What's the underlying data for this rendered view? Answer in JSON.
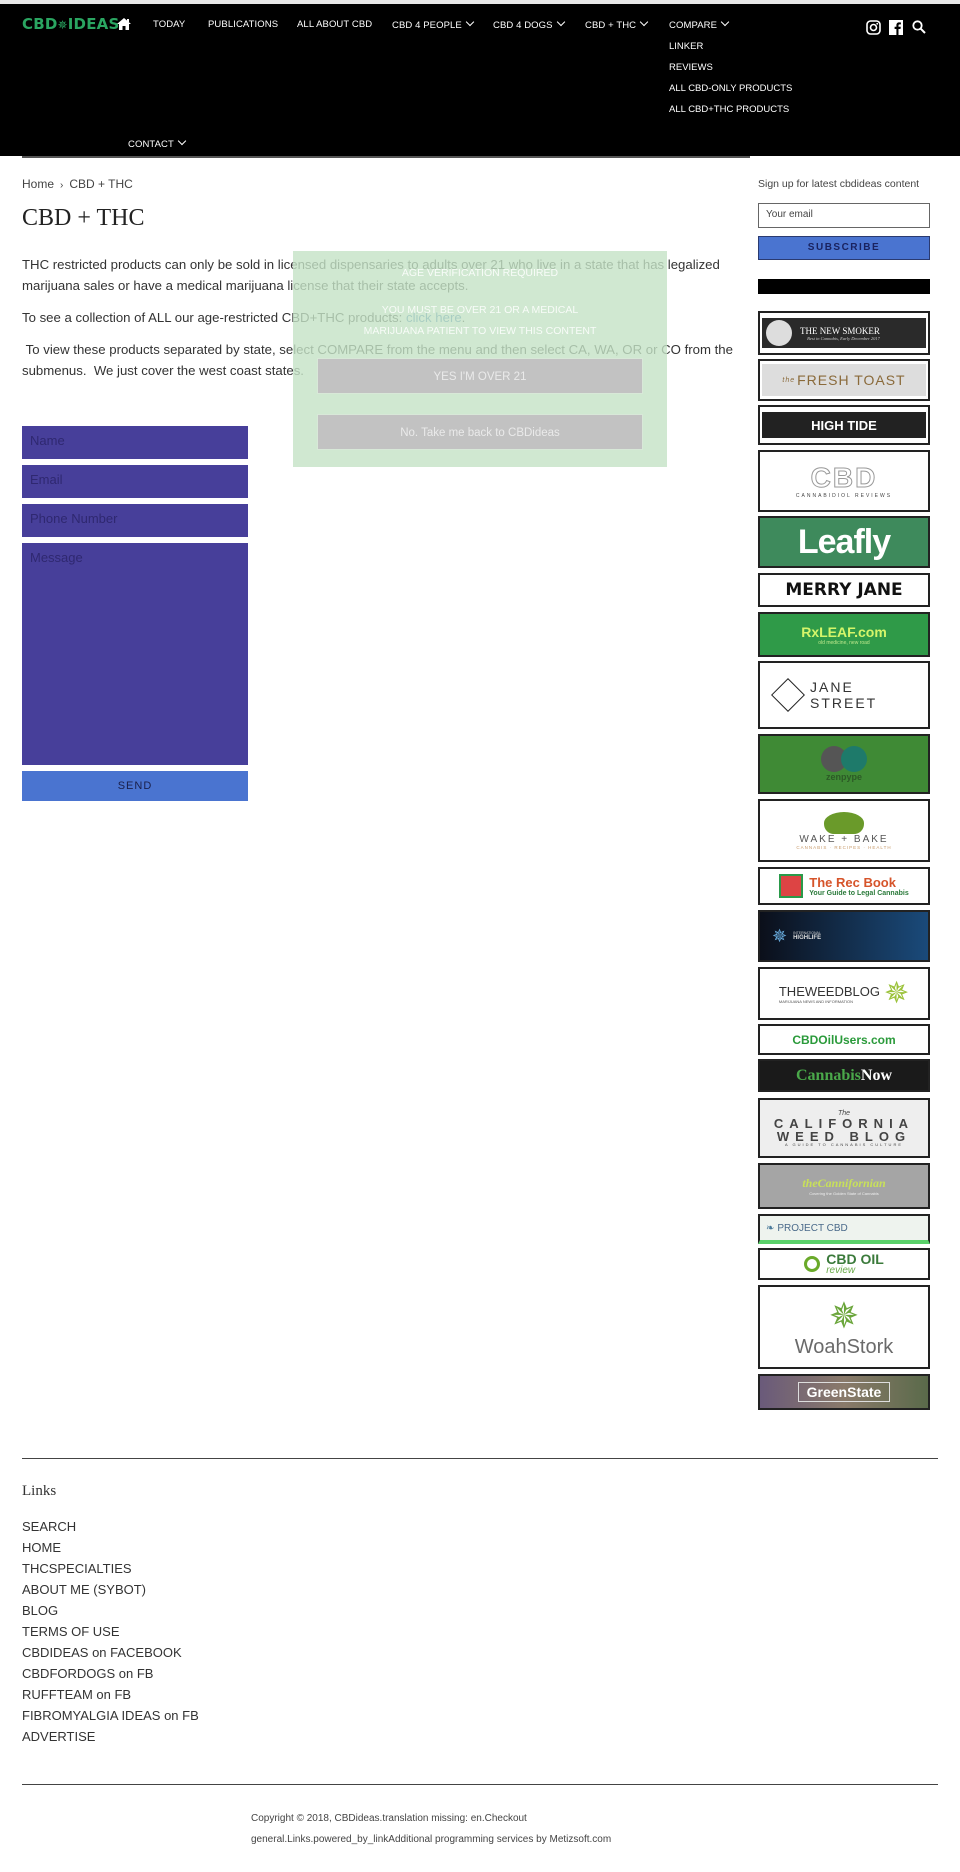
{
  "header": {
    "logo": {
      "left": "CBD",
      "leaf": "✵",
      "right": "IDEAS"
    },
    "nav": [
      {
        "label": "TODAY",
        "dropdown": false
      },
      {
        "label": "PUBLICATIONS",
        "dropdown": false
      },
      {
        "label": "ALL ABOUT CBD",
        "dropdown": false
      },
      {
        "label": "CBD 4 PEOPLE",
        "dropdown": true
      },
      {
        "label": "CBD 4 DOGS",
        "dropdown": true
      },
      {
        "label": "CBD + THC",
        "dropdown": true
      },
      {
        "label": "COMPARE",
        "dropdown": true
      },
      {
        "label": "CONTACT",
        "dropdown": true
      }
    ],
    "compare_submenu": [
      "LINKER",
      "REVIEWS",
      "ALL CBD-ONLY PRODUCTS",
      "ALL CBD+THC PRODUCTS"
    ],
    "icons": [
      "home-icon",
      "instagram-icon",
      "facebook-icon",
      "search-icon"
    ]
  },
  "breadcrumb": {
    "home": "Home",
    "separator": "›",
    "current": "CBD + THC"
  },
  "page_title": "CBD + THC",
  "content": {
    "p1": "THC restricted products can only be sold in licensed dispensaries to adults over 21 who live in a state that has legalized marijuana sales or have a medical marijuana license that their state accepts.",
    "p2_text": "To see a collection of ALL our age-restricted CBD+THC products: ",
    "p2_link": "click here",
    "p2_end": ".",
    "p3": " To view these products separated by state, select COMPARE from the menu and then select CA, WA, OR or CO from the submenus.  We just cover the west coast states."
  },
  "age_gate": {
    "title": "AGE VERIFICATION REQUIRED",
    "message_line1": "YOU MUST BE OVER 21 OR A MEDICAL",
    "message_line2": "MARIJUANA PATIENT TO VIEW THIS CONTENT",
    "yes_button": "YES I'M OVER 21",
    "no_button": "No. Take me back to CBDideas"
  },
  "contact_form": {
    "name_placeholder": "Name",
    "email_placeholder": "Email",
    "phone_placeholder": "Phone Number",
    "message_placeholder": "Message",
    "send_label": "SEND"
  },
  "sidebar": {
    "signup_heading": "Sign up for latest cbdideas content",
    "email_placeholder": "Your email",
    "subscribe_label": "SUBSCRIBE",
    "banners": [
      {
        "name": "THE NEW SMOKER",
        "sub": "Best in Cannabis, Early December 2017"
      },
      {
        "name": "FRESH TOAST",
        "sub": "the"
      },
      {
        "name": "HIGH TIDE"
      },
      {
        "name": "CBD",
        "sub": "CANNABIDIOL REVIEWS"
      },
      {
        "name": "Leafly"
      },
      {
        "name": "MERRY JANE"
      },
      {
        "name": "RxLEAF.com",
        "sub": "old medicine, new road"
      },
      {
        "name": "JANE STREET"
      },
      {
        "name": "zenpype"
      },
      {
        "name": "WAKE + BAKE",
        "sub": "CANNABIS · RECIPES · HEALTH"
      },
      {
        "name": "The Rec Book",
        "sub": "Your Guide to Legal Cannabis"
      },
      {
        "name": "HIGHLIFE",
        "sub": "INTERNATIONAL"
      },
      {
        "name": "THEWEEDBLOG",
        "sub": "MARIJUANA NEWS AND INFORMATION"
      },
      {
        "name": "CBDOilUsers.com"
      },
      {
        "name": "Cannabis",
        "name2": "Now"
      },
      {
        "name": "CALIFORNIA",
        "name2": "WEED BLOG",
        "sub": "A GUIDE TO CANNABIS CULTURE",
        "pre": "The"
      },
      {
        "name": "theCannifornian",
        "sub": "Covering the Golden State of Cannabis"
      },
      {
        "name": "PROJECT CBD"
      },
      {
        "name": "CBD OIL",
        "sub": "review"
      },
      {
        "name": "WoahStork"
      },
      {
        "name": "GreenState"
      }
    ]
  },
  "footer": {
    "links_heading": "Links",
    "links": [
      "SEARCH",
      "HOME",
      "THCSPECIALTIES",
      "ABOUT ME (SYBOT)",
      "BLOG",
      "TERMS OF USE",
      "CBDIDEAS on FACEBOOK",
      "CBDFORDOGS on FB",
      "RUFFTEAM on FB",
      "FIBROMYALGIA IDEAS on FB",
      "ADVERTISE"
    ],
    "copyright": "Copyright © 2018, CBDideas.translation missing: en.Checkout",
    "powered": "general.Links.powered_by_linkAdditional programming services by Metizsoft.com"
  },
  "colors": {
    "brand_green": "#2aa561",
    "form_purple": "#473f9a",
    "button_blue": "#4a74d0",
    "link_blue": "#3a78b5",
    "overlay_green": "#c4e2c6"
  }
}
